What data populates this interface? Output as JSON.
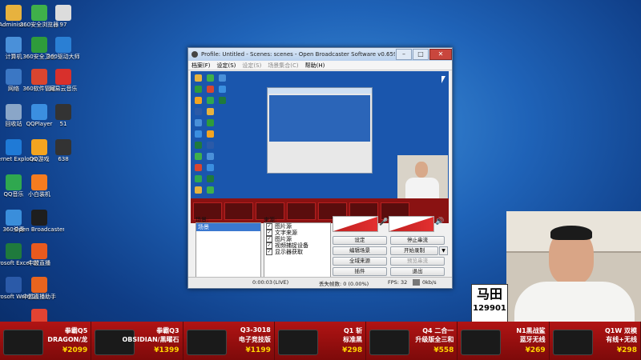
{
  "desktop": {
    "icons": [
      {
        "label": "Administ...",
        "color": "#e7b23e"
      },
      {
        "label": "360安全浏览器",
        "color": "#3fb04a"
      },
      {
        "label": "97",
        "color": "#dcdcdc"
      },
      {
        "label": "计算机",
        "color": "#4a90d9"
      },
      {
        "label": "360安全卫士",
        "color": "#2e9b3b"
      },
      {
        "label": "360驱动大师",
        "color": "#2a7fd4"
      },
      {
        "label": "网络",
        "color": "#3b77c4"
      },
      {
        "label": "360软件管家",
        "color": "#d9452f"
      },
      {
        "label": "网易云音乐",
        "color": "#d8302c"
      },
      {
        "label": "回收站",
        "color": "#8aa6c8"
      },
      {
        "label": "QQPlayer",
        "color": "#3b8fe0"
      },
      {
        "label": "51",
        "color": "#333333"
      },
      {
        "label": "Internet Explorer",
        "color": "#1f7ad6"
      },
      {
        "label": "QQ游戏",
        "color": "#f3a420"
      },
      {
        "label": "638",
        "color": "#333333"
      },
      {
        "label": "QQ音乐",
        "color": "#2fa84f"
      },
      {
        "label": "小白装机",
        "color": "#f57c1f"
      },
      {
        "label": "360杀毒",
        "color": "#3a8edb"
      },
      {
        "label": "Open Broadcaster...",
        "color": "#1e1e1e"
      },
      {
        "label": "Microsoft Excel 2010",
        "color": "#1f7a3d"
      },
      {
        "label": "中盟直播",
        "color": "#e85a1e"
      },
      {
        "label": "Microsoft Word 2010",
        "color": "#2b5aa8"
      },
      {
        "label": "中盟直播助手",
        "color": "#e8641e"
      },
      {
        "label": "",
        "color": "#e24332"
      }
    ]
  },
  "obs": {
    "title": "Profile: Untitled - Scenes: scenes - Open Broadcaster Software v0.659b",
    "menu": [
      "档案(F)",
      "设定(S)",
      "设定(S)",
      "场景集合(C)",
      "帮助(H)"
    ],
    "scenes_label": "场景:",
    "scenes": [
      "场景"
    ],
    "sources_label": "来源:",
    "sources": [
      "图片源",
      "文字来源",
      "图片源",
      "视频捕捉设备",
      "显示器获取"
    ],
    "buttons": {
      "settings": "设定",
      "stop_stream": "停止串流",
      "edit_scene": "编辑场景",
      "start_record": "开始录制",
      "global_sources": "全域来源",
      "preview_stream": "预览串流",
      "plugins": "插件",
      "exit": "退出"
    },
    "status": {
      "time": "0:00:03",
      "live": "(LIVE)",
      "dropped": "丢失帧数: 0 (0.00%)",
      "fps": "FPS: 32",
      "bitrate": "0kb/s"
    }
  },
  "overlay": {
    "logo_text": "马田",
    "logo_number": "129901"
  },
  "ticker": [
    {
      "name": "拳霸Q5",
      "name2": "DRAGON/龙",
      "price": "¥2099"
    },
    {
      "name": "拳霸Q3",
      "name2": "OBSIDIAN/黑曜石",
      "price": "¥1399"
    },
    {
      "name": "Q3-3018",
      "name2": "电子竞技版",
      "price": "¥1199"
    },
    {
      "name": "Q1 斩",
      "name2": "标准黑",
      "price": "¥298"
    },
    {
      "name": "Q4 二合一",
      "name2": "升级版全三和",
      "price": "¥558"
    },
    {
      "name": "N1黑战鲨",
      "name2": "蓝牙无线",
      "price": "¥269"
    },
    {
      "name": "Q1W 双模",
      "name2": "有线+无线",
      "price": "¥298"
    }
  ]
}
